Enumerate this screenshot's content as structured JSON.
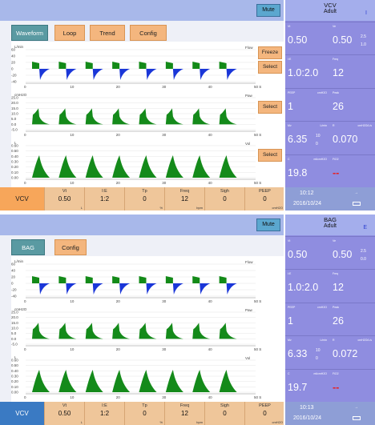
{
  "colors": {
    "flow_fill": "#1a36d8",
    "flow_fill_up": "#138a18",
    "wave_fill": "#148a1a",
    "monitor_bg": "#8f8de0",
    "header_bg": "#a8b8ea",
    "button_orange": "#f4b67e",
    "tab_active": "#5a9aa2",
    "alarm_red": "#e82020"
  },
  "screens": [
    {
      "mute_label": "Mute",
      "tabs": [
        {
          "label": "Waveform",
          "active": true
        },
        {
          "label": "Loop",
          "active": false
        },
        {
          "label": "Trend",
          "active": false
        },
        {
          "label": "Config",
          "active": false
        }
      ],
      "plots": [
        {
          "unit": "L/min",
          "name": "Flow",
          "buttons": [
            "Freeze",
            "Select"
          ],
          "yticks": [
            "60",
            "40",
            "20",
            "0",
            "-20",
            "-40"
          ],
          "xticks": [
            "0",
            "10",
            "20",
            "30",
            "40",
            "50 S"
          ]
        },
        {
          "unit": "cmH2O",
          "name": "Paw",
          "buttons": [
            "Select"
          ],
          "yticks": [
            "25.0",
            "20.0",
            "15.0",
            "10.0",
            "5.0",
            "0.0",
            "-5.0"
          ],
          "xticks": [
            "0",
            "10",
            "20",
            "30",
            "40",
            "50 S"
          ]
        },
        {
          "unit": "L",
          "name": "Vol",
          "buttons": [
            "Select"
          ],
          "yticks": [
            "0.60",
            "0.50",
            "0.40",
            "0.30",
            "0.20",
            "0.10",
            "0.00"
          ],
          "xticks": [
            "0",
            "10",
            "20",
            "30",
            "40",
            "50 S"
          ]
        }
      ],
      "mode": "VCV",
      "params": [
        {
          "label": "Vt",
          "value": "0.50",
          "unit": "L"
        },
        {
          "label": "I:E",
          "value": "1:2",
          "unit": ""
        },
        {
          "label": "Tp",
          "value": "0",
          "unit": "%"
        },
        {
          "label": "Freq",
          "value": "12",
          "unit": "bpm"
        },
        {
          "label": "Sigh",
          "value": "0",
          "unit": ""
        },
        {
          "label": "PEEP",
          "value": "0",
          "unit": "cmH2O"
        }
      ],
      "header": {
        "mode": "VCV",
        "patient": "Adult",
        "flag": "I"
      },
      "monitor": [
        {
          "l_label": "Vt",
          "l_value": "0.50",
          "r_label": "Ve",
          "r_value": "0.50",
          "r_sub": "2.5",
          "r_sub2": "1.0"
        },
        {
          "l_label": "I:E",
          "l_value": "1.0:2.0",
          "r_label": "Freq",
          "r_value": "12"
        },
        {
          "l_label": "PEEP",
          "l_unit": "cmH2O",
          "l_value": "1",
          "r_label": "Peak",
          "r_value": "26"
        },
        {
          "l_label": "Mv",
          "l_unit": "L/min",
          "l_value": "6.35",
          "l_sub": "10",
          "l_sub2": "0",
          "r_label": "R",
          "r_unit": "cmH2O/L/s",
          "r_value": "0.070"
        },
        {
          "l_label": "C",
          "l_unit": "ml/cmH2O",
          "l_value": "19.8",
          "r_label": "FiO2",
          "r_value": "--"
        }
      ],
      "time": "10:12",
      "date": "2016/10/24"
    },
    {
      "mute_label": "Mute",
      "tabs": [
        {
          "label": "BAG",
          "active": true
        },
        {
          "label": "Config",
          "active": false
        }
      ],
      "plots": [
        {
          "unit": "L/min",
          "name": "Flow",
          "buttons": [],
          "yticks": [
            "60",
            "40",
            "20",
            "0",
            "-20",
            "-40"
          ],
          "xticks": [
            "0",
            "10",
            "20",
            "30",
            "40",
            "50 S"
          ]
        },
        {
          "unit": "cmH2O",
          "name": "Paw",
          "buttons": [],
          "yticks": [
            "25.0",
            "20.0",
            "15.0",
            "10.0",
            "5.0",
            "0.0",
            "-5.0"
          ],
          "xticks": [
            "0",
            "10",
            "20",
            "30",
            "40",
            "50 S"
          ]
        },
        {
          "unit": "L",
          "name": "Vol",
          "buttons": [],
          "yticks": [
            "0.60",
            "0.50",
            "0.40",
            "0.30",
            "0.20",
            "0.10",
            "0.00"
          ],
          "xticks": [
            "0",
            "10",
            "20",
            "30",
            "40",
            "50 S"
          ]
        }
      ],
      "mode": "VCV",
      "params": [
        {
          "label": "Vt",
          "value": "0.50",
          "unit": "L"
        },
        {
          "label": "I:E",
          "value": "1:2",
          "unit": ""
        },
        {
          "label": "Tp",
          "value": "0",
          "unit": "%"
        },
        {
          "label": "Freq",
          "value": "12",
          "unit": "bpm"
        },
        {
          "label": "Sigh",
          "value": "0",
          "unit": ""
        },
        {
          "label": "PEEP",
          "value": "0",
          "unit": "cmH2O"
        }
      ],
      "header": {
        "mode": "BAG",
        "patient": "Adult",
        "flag": "E"
      },
      "monitor": [
        {
          "l_label": "Vt",
          "l_value": "0.50",
          "r_label": "Ve",
          "r_value": "0.50",
          "r_sub": "2.5",
          "r_sub2": "0.0"
        },
        {
          "l_label": "I:E",
          "l_value": "1.0:2.0",
          "r_label": "Freq",
          "r_value": "12"
        },
        {
          "l_label": "PEEP",
          "l_unit": "cmH2O",
          "l_value": "1",
          "r_label": "Peak",
          "r_value": "26"
        },
        {
          "l_label": "Mv",
          "l_unit": "L/min",
          "l_value": "6.33",
          "l_sub": "10",
          "l_sub2": "0",
          "r_label": "R",
          "r_unit": "cmH2O/L/s",
          "r_value": "0.072"
        },
        {
          "l_label": "C",
          "l_unit": "ml/cmH2O",
          "l_value": "19.7",
          "r_label": "FiO2",
          "r_value": "--"
        }
      ],
      "time": "10:13",
      "date": "2016/10/24"
    }
  ]
}
